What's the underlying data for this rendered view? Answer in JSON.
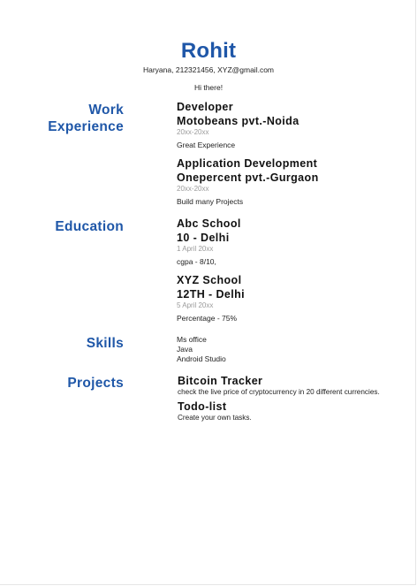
{
  "header": {
    "name": "Rohit",
    "contact": "Haryana, 212321456, XYZ@gmail.com",
    "greeting": "Hi there!"
  },
  "sections": {
    "work": {
      "title_line1": "Work",
      "title_line2": "Experience",
      "entries": [
        {
          "role": "Developer",
          "company": "Motobeans pvt.-Noida",
          "date": "20xx-20xx",
          "description": "Great Experience"
        },
        {
          "role": "Application Development",
          "company": "Onepercent pvt.-Gurgaon",
          "date": "20xx-20xx",
          "description": "Build many Projects"
        }
      ]
    },
    "education": {
      "title": "Education",
      "entries": [
        {
          "school": "Abc School",
          "grade": "10 - Delhi",
          "date": "1 April 20xx",
          "score": "cgpa - 8/10,"
        },
        {
          "school": "XYZ School",
          "grade": "12TH - Delhi",
          "date": "5 April 20xx",
          "score": "Percentage - 75%"
        }
      ]
    },
    "skills": {
      "title": "Skills",
      "items": [
        "Ms office",
        "Java",
        "Android Studio"
      ]
    },
    "projects": {
      "title": "Projects",
      "items": [
        {
          "name": "Bitcoin Tracker",
          "description": "check the live price of cryptocurrency in 20 different currencies."
        },
        {
          "name": "Todo-list",
          "description": "Create your own tasks."
        }
      ]
    }
  }
}
